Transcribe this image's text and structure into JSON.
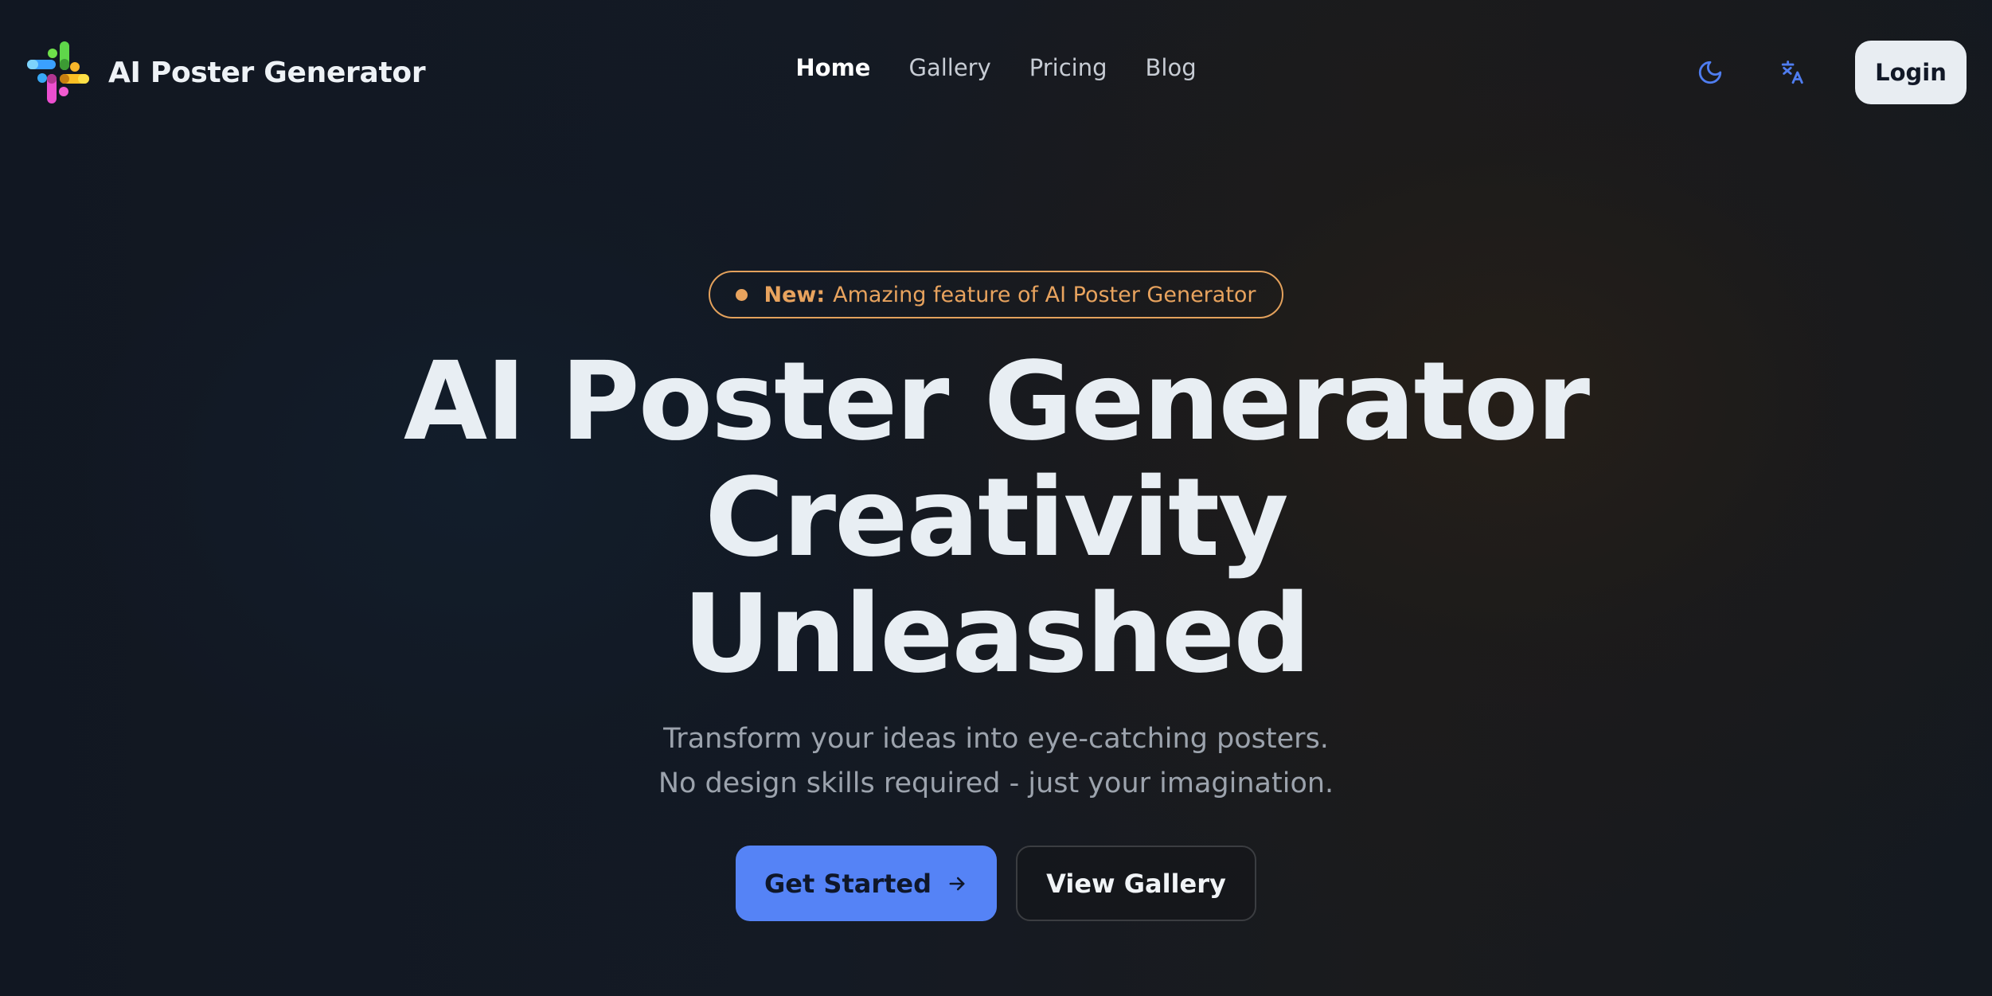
{
  "header": {
    "brand_name": "AI Poster Generator",
    "logo_icon": "colorful-cross-logo-icon",
    "nav": [
      {
        "label": "Home",
        "active": true
      },
      {
        "label": "Gallery",
        "active": false
      },
      {
        "label": "Pricing",
        "active": false
      },
      {
        "label": "Blog",
        "active": false
      }
    ],
    "theme_toggle_icon": "moon-icon",
    "language_icon": "translate-icon",
    "login_label": "Login",
    "icon_color": "#4f7df0"
  },
  "hero": {
    "badge": {
      "prefix": "New:",
      "text": "Amazing feature of AI Poster Generator",
      "color": "#e8a35e"
    },
    "title_lines": [
      "AI Poster Generator",
      "Creativity",
      "Unleashed"
    ],
    "subtitle_lines": [
      "Transform your ideas into eye-catching posters.",
      "No design skills required - just your imagination."
    ],
    "primary_cta": {
      "label": "Get Started",
      "icon": "arrow-right-icon",
      "color": "#5583f6"
    },
    "secondary_cta": {
      "label": "View Gallery"
    }
  }
}
